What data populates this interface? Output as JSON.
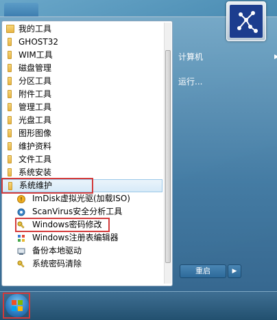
{
  "left_items": [
    {
      "label": "我的工具",
      "icon": "gear-folder-icon"
    },
    {
      "label": "GHOST32",
      "icon": "folder-icon"
    },
    {
      "label": "WIM工具",
      "icon": "folder-icon"
    },
    {
      "label": "磁盘管理",
      "icon": "folder-icon"
    },
    {
      "label": "分区工具",
      "icon": "folder-icon"
    },
    {
      "label": "附件工具",
      "icon": "folder-icon"
    },
    {
      "label": "管理工具",
      "icon": "folder-icon"
    },
    {
      "label": "光盘工具",
      "icon": "folder-icon"
    },
    {
      "label": "图形图像",
      "icon": "folder-icon"
    },
    {
      "label": "维护资料",
      "icon": "folder-icon"
    },
    {
      "label": "文件工具",
      "icon": "folder-icon"
    },
    {
      "label": "系统安装",
      "icon": "folder-icon"
    },
    {
      "label": "系统维护",
      "icon": "folder-icon"
    }
  ],
  "sub_items": [
    {
      "label": "ImDisk虚拟光驱(加载ISO)",
      "icon": "imdisk-icon"
    },
    {
      "label": "ScanVirus安全分析工具",
      "icon": "scan-icon"
    },
    {
      "label": "Windows密码修改",
      "icon": "key-icon"
    },
    {
      "label": "Windows注册表编辑器",
      "icon": "regedit-icon"
    },
    {
      "label": "备份本地驱动",
      "icon": "backup-icon"
    },
    {
      "label": "系统密码清除",
      "icon": "key-icon"
    }
  ],
  "right_items": [
    {
      "label": "计算机"
    },
    {
      "label": "运行..."
    }
  ],
  "restart": {
    "label": "重启"
  },
  "colors": {
    "highlight_box": "#d33a3a",
    "selected_bg": "#d7eaf8",
    "taskbar": "#22506f"
  }
}
